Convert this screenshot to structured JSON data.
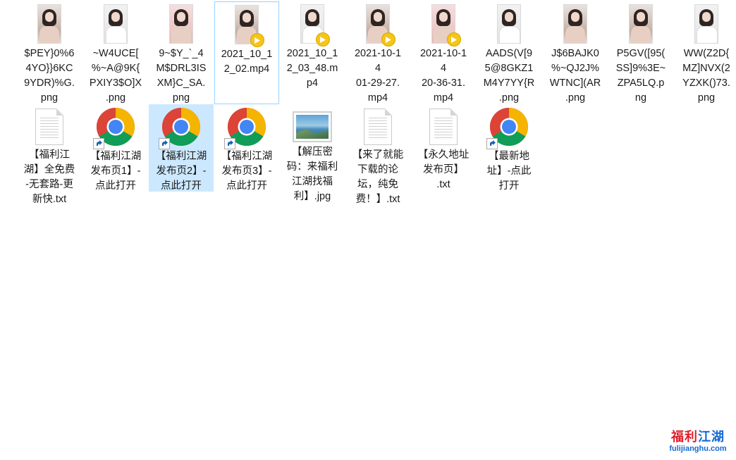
{
  "files": [
    {
      "name": "$PEY}0%6\n4YO}}6KC\n9YDR)%G.\npng",
      "type": "image",
      "selected": false
    },
    {
      "name": "~W4UCE[\n%~A@9K{\nPXIY3$O]X\n.png",
      "type": "image",
      "selected": false
    },
    {
      "name": "9~$Y_`_4\nM$DRL3IS\nXM}C_SA.\npng",
      "type": "image",
      "selected": false
    },
    {
      "name": "2021_10_1\n2_02.mp4",
      "type": "video",
      "selected": "outline"
    },
    {
      "name": "2021_10_1\n2_03_48.m\np4",
      "type": "video",
      "selected": false
    },
    {
      "name": "2021-10-1\n4\n01-29-27.\nmp4",
      "type": "video",
      "selected": false
    },
    {
      "name": "2021-10-1\n4\n20-36-31.\nmp4",
      "type": "video",
      "selected": false
    },
    {
      "name": "AADS(V[9\n5@8GKZ1\nM4Y7YY{R\n.png",
      "type": "image",
      "selected": false
    },
    {
      "name": "J$6BAJK0\n%~QJ2J%\nWTNC](AR\n.png",
      "type": "image",
      "selected": false
    },
    {
      "name": "P5GV([95(\nSS]9%3E~\nZPA5LQ.p\nng",
      "type": "image",
      "selected": false
    },
    {
      "name": "WW(Z2D{\nMZ]NVX(2\nYZXK()73.\npng",
      "type": "image",
      "selected": false
    },
    {
      "name": "【福利江\n湖】全免费\n-无套路-更\n新快.txt",
      "type": "txt",
      "selected": false
    },
    {
      "name": "【福利江湖\n发布页1】-\n点此打开",
      "type": "chrome",
      "selected": false
    },
    {
      "name": "【福利江湖\n发布页2】-\n点此打开",
      "type": "chrome",
      "selected": "fill"
    },
    {
      "name": "【福利江湖\n发布页3】-\n点此打开",
      "type": "chrome",
      "selected": false
    },
    {
      "name": "【解压密\n码：来福利\n江湖找福\n利】.jpg",
      "type": "jpg",
      "selected": false
    },
    {
      "name": "【来了就能\n下载的论\n坛，纯免\n费！】.txt",
      "type": "txt",
      "selected": false
    },
    {
      "name": "【永久地址\n发布页】\n.txt",
      "type": "txt",
      "selected": false
    },
    {
      "name": "【最新地\n址】-点此\n打开",
      "type": "chrome",
      "selected": false
    }
  ],
  "icons": {
    "image": "image-thumbnail-icon",
    "video": "video-thumbnail-icon",
    "txt": "text-file-icon",
    "chrome": "chrome-shortcut-icon",
    "jpg": "jpg-image-icon"
  },
  "colors": {
    "selection_fill": "#cce8ff",
    "selection_outline": "#99d1ff",
    "play_badge": "#f5c518"
  },
  "watermark": {
    "title_red": "福利",
    "title_blue": "江湖",
    "url": "fulijianghu.com"
  }
}
